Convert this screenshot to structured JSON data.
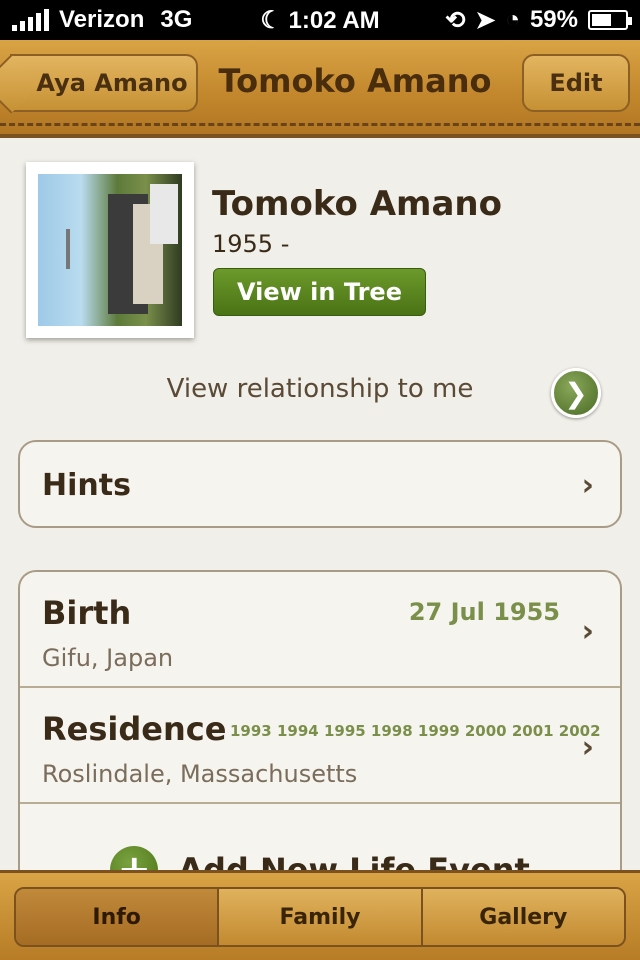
{
  "status_bar": {
    "carrier": "Verizon",
    "network": "3G",
    "time": "1:02 AM",
    "battery": "59%",
    "battery_level": 0.59
  },
  "nav": {
    "back_label": "Aya Amano",
    "title": "Tomoko Amano",
    "edit_label": "Edit"
  },
  "profile": {
    "name": "Tomoko Amano",
    "dates": "1955 -",
    "view_tree_label": "View in Tree",
    "relationship_label": "View relationship to me"
  },
  "hints": {
    "label": "Hints"
  },
  "events": [
    {
      "title": "Birth",
      "date": "27 Jul 1955",
      "place": "Gifu, Japan"
    },
    {
      "title": "Residence",
      "years": "1993 1994 1995 1998 1999 2000 2001 2002",
      "place": "Roslindale, Massachusetts"
    }
  ],
  "add_event": {
    "label": "Add New Life Event"
  },
  "tabs": [
    {
      "label": "Info"
    },
    {
      "label": "Family"
    },
    {
      "label": "Gallery"
    }
  ],
  "colors": {
    "accent_green": "#4a7315",
    "leather": "#c2862c",
    "date_green": "#7a8f4a"
  }
}
